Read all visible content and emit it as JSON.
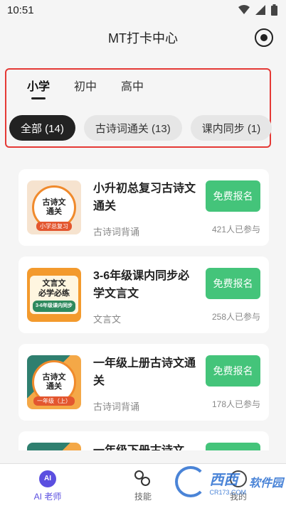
{
  "status_bar": {
    "time": "10:51",
    "icons": [
      "wifi-icon",
      "signal-icon",
      "battery-icon"
    ]
  },
  "header": {
    "title": "MT打卡中心",
    "action_icon": "target-icon"
  },
  "level_tabs": [
    {
      "label": "小学",
      "active": true
    },
    {
      "label": "初中",
      "active": false
    },
    {
      "label": "高中",
      "active": false
    }
  ],
  "chips": [
    {
      "label": "全部 (14)",
      "active": true
    },
    {
      "label": "古诗词通关 (13)",
      "active": false
    },
    {
      "label": "课内同步 (1)",
      "active": false
    }
  ],
  "courses": [
    {
      "title": "小升初总复习古诗文通关",
      "category": "古诗词背诵",
      "button": "免费报名",
      "participants": "421人已参与",
      "thumb": {
        "line1": "古诗文",
        "line2": "通关",
        "tag": "小学总复习"
      }
    },
    {
      "title": "3-6年级课内同步必学文言文",
      "category": "文言文",
      "button": "免费报名",
      "participants": "258人已参与",
      "thumb": {
        "line1": "文言文",
        "line2": "必学必练",
        "tag": "3-6年级课内同步"
      }
    },
    {
      "title": "一年级上册古诗文通关",
      "category": "古诗词背诵",
      "button": "免费报名",
      "participants": "178人已参与",
      "thumb": {
        "line1": "古诗文",
        "line2": "通关",
        "tag": "一年级（上）"
      }
    },
    {
      "title": "一年级下册古诗文",
      "category": "",
      "button": "",
      "participants": "",
      "thumb": {
        "line1": "",
        "line2": "",
        "tag": ""
      }
    }
  ],
  "bottom_nav": [
    {
      "label": "AI 老师",
      "icon": "ai-teacher-icon",
      "icon_text": "AI",
      "active": true
    },
    {
      "label": "技能",
      "icon": "skills-icon",
      "active": false
    },
    {
      "label": "我的",
      "icon": "profile-icon",
      "active": false
    }
  ],
  "watermark": {
    "main": "西西",
    "sub": "CR173.COM",
    "extra": "软件园"
  },
  "colors": {
    "accent_green": "#44c47a",
    "chip_active": "#222222",
    "highlight_border": "#e53935",
    "nav_active": "#5b4fe0"
  }
}
